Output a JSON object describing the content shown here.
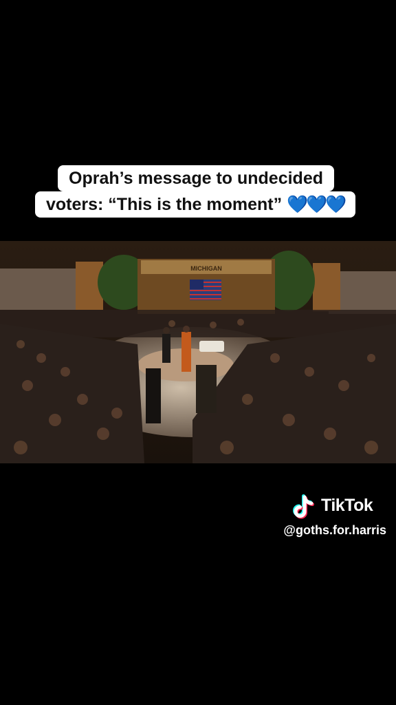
{
  "caption": {
    "line1": "Oprah’s message to undecided",
    "line2": "voters: “This is the moment”",
    "emoji": "💙💙💙"
  },
  "video": {
    "description_icon": "play-area",
    "sign_text": "MICHIGAN",
    "accent_colors": {
      "stage_gold": "#a07a44",
      "stage_orange": "#c35a1c",
      "audience_dark": "#2a201b"
    }
  },
  "watermark": {
    "brand": "TikTok",
    "handle": "@goths.for.harris",
    "logo_icon": "tiktok-logo-icon",
    "colors": {
      "cyan": "#25f4ee",
      "red": "#fe2c55",
      "white": "#ffffff"
    }
  }
}
